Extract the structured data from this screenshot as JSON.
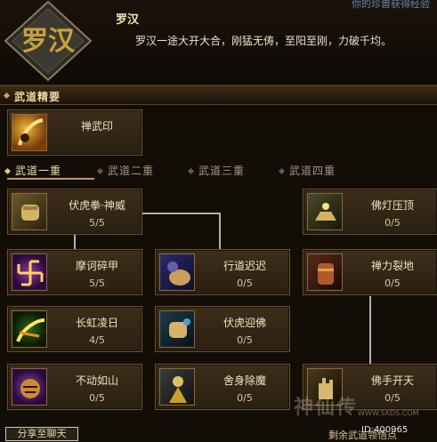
{
  "header": {
    "emblem_glyph": "罗汉",
    "top_notice": "你的珍兽获得经验",
    "class_name": "罗汉",
    "class_desc": "罗汉一途大开大合，刚猛无俦，至阳至刚，力破千均。"
  },
  "section": {
    "title": "武道精要"
  },
  "essence_card": {
    "label": "禅武印"
  },
  "tabs": [
    "武道一重",
    "武道二重",
    "武道三重",
    "武道四重"
  ],
  "active_tab": "武道一重",
  "skills": [
    {
      "label": "伏虎拳·神威",
      "count": "5/5",
      "icon": "fist-icon"
    },
    {
      "label": "摩诃碎甲",
      "count": "5/5",
      "icon": "swastika-icon"
    },
    {
      "label": "行道迟迟",
      "count": "0/5",
      "icon": "palm-icon"
    },
    {
      "label": "长虹凌日",
      "count": "4/5",
      "icon": "rainbow-icon"
    },
    {
      "label": "伏虎迎佛",
      "count": "0/5",
      "icon": "fist-icon"
    },
    {
      "label": "不动如山",
      "count": "0/5",
      "icon": "tiger-icon"
    },
    {
      "label": "舍身除魔",
      "count": "0/5",
      "icon": "monk-icon"
    },
    {
      "label": "佛灯压顶",
      "count": "0/5",
      "icon": "lamp-icon"
    },
    {
      "label": "禅力裂地",
      "count": "0/5",
      "icon": "gauntlet-icon"
    },
    {
      "label": "佛手开天",
      "count": "0/5",
      "icon": "hand-icon"
    }
  ],
  "footer": {
    "share_label": "分享至聊天",
    "remaining_label": "剩余武道领悟点",
    "id_badge": "ID:400965",
    "watermark": "神仙传",
    "watermark_url": "WWW.SXDS.COM"
  },
  "colors": {
    "accent": "#c79a4e",
    "panel": "#3d2e1a",
    "text": "#f1e2bd"
  }
}
